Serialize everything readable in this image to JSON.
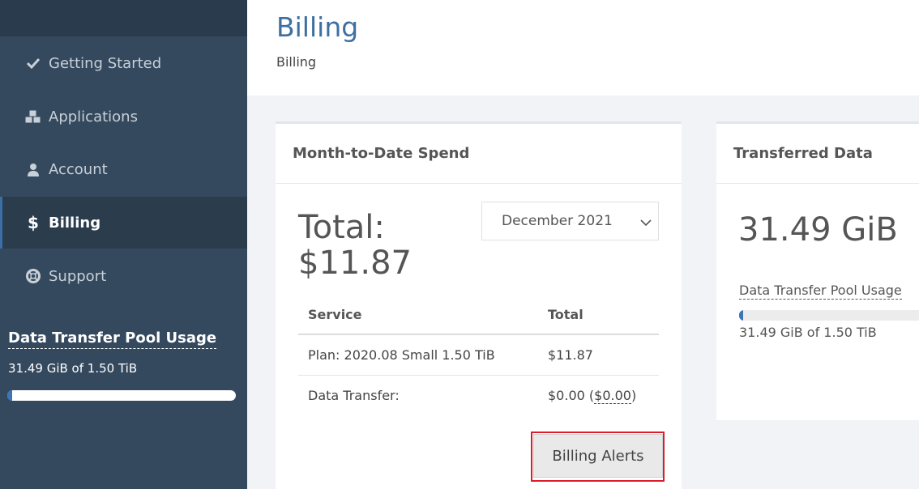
{
  "sidebar": {
    "items": [
      {
        "label": "Getting Started",
        "icon": "check-icon"
      },
      {
        "label": "Applications",
        "icon": "cubes-icon"
      },
      {
        "label": "Account",
        "icon": "user-icon"
      },
      {
        "label": "Billing",
        "icon": "dollar-icon",
        "active": true
      },
      {
        "label": "Support",
        "icon": "lifebuoy-icon"
      }
    ],
    "pool": {
      "title": "Data Transfer Pool Usage",
      "text": "31.49 GiB of 1.50 TiB",
      "fraction": 0.02
    }
  },
  "header": {
    "title": "Billing",
    "breadcrumb": "Billing"
  },
  "spend": {
    "title": "Month-to-Date Spend",
    "total": "Total: $11.87",
    "month": "December 2021",
    "columns": [
      "Service",
      "Total"
    ],
    "rows": [
      {
        "service": "Plan: 2020.08 Small 1.50 TiB",
        "total": "$11.87"
      },
      {
        "service": "Data Transfer:",
        "total": "$0.00",
        "total_extra": "$0.00"
      }
    ],
    "alerts_label": "Billing Alerts"
  },
  "transfer": {
    "title": "Transferred Data",
    "value": "31.49 GiB",
    "pool_link": "Data Transfer Pool Usage",
    "pool_text": "31.49 GiB of 1.50 TiB",
    "fraction": 0.02
  },
  "colors": {
    "sidebar_bg": "#34495e",
    "accent": "#3d6fa0",
    "progress": "#3a76b5",
    "highlight": "#d91e2a"
  }
}
